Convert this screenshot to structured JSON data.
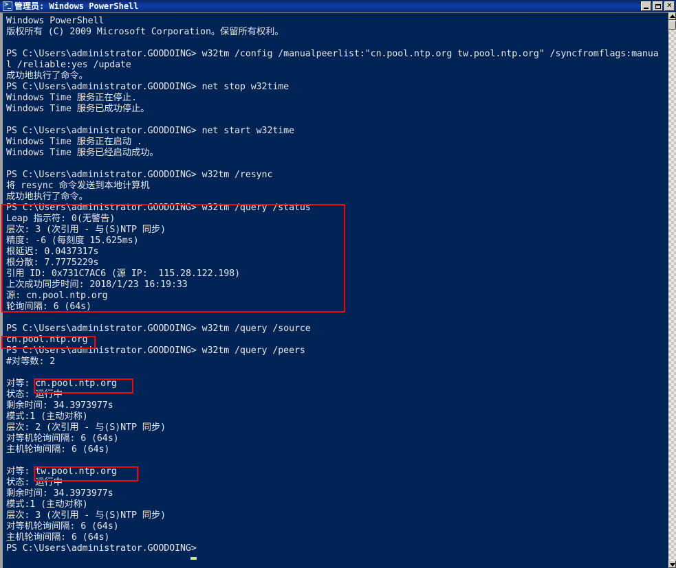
{
  "window": {
    "title": "管理员: Windows PowerShell",
    "icon": "powershell-icon",
    "buttons": {
      "minimize": "_",
      "maximize": "□",
      "close": "✕"
    },
    "background_color": "#012456",
    "text_color": "#e8e8e8",
    "annotation_color": "#ff0000",
    "cursor_color": "#c8e6a0"
  },
  "scrollbar": {
    "up_arrow": "▲",
    "down_arrow": "▼",
    "thumb": "scroll-thumb"
  },
  "console": {
    "prompt": "PS C:\\Users\\administrator.GOODOING>",
    "lines": [
      "Windows PowerShell",
      "版权所有 (C) 2009 Microsoft Corporation。保留所有权利。",
      "",
      "PS C:\\Users\\administrator.GOODOING> w32tm /config /manualpeerlist:\"cn.pool.ntp.org tw.pool.ntp.org\" /syncfromflags:manua",
      "l /reliable:yes /update",
      "成功地执行了命令。",
      "PS C:\\Users\\administrator.GOODOING> net stop w32time",
      "Windows Time 服务正在停止.",
      "Windows Time 服务已成功停止。",
      "",
      "PS C:\\Users\\administrator.GOODOING> net start w32time",
      "Windows Time 服务正在启动 .",
      "Windows Time 服务已经启动成功。",
      "",
      "PS C:\\Users\\administrator.GOODOING> w32tm /resync",
      "将 resync 命令发送到本地计算机",
      "成功地执行了命令。",
      "PS C:\\Users\\administrator.GOODOING> w32tm /query /status",
      "Leap 指示符: 0(无警告)",
      "层次: 3 (次引用 - 与(S)NTP 同步)",
      "精度: -6 (每刻度 15.625ms)",
      "根延迟: 0.0437317s",
      "根分散: 7.7775229s",
      "引用 ID: 0x731C7AC6 (源 IP:  115.28.122.198)",
      "上次成功同步时间: 2018/1/23 16:19:33",
      "源: cn.pool.ntp.org",
      "轮询间隔: 6 (64s)",
      "",
      "PS C:\\Users\\administrator.GOODOING> w32tm /query /source",
      "cn.pool.ntp.org",
      "PS C:\\Users\\administrator.GOODOING> w32tm /query /peers",
      "#对等数: 2",
      "",
      "对等: cn.pool.ntp.org",
      "状态: 运行中",
      "剩余时间: 34.3973977s",
      "模式:1 (主动对称)",
      "层次: 2 (次引用 - 与(S)NTP 同步)",
      "对等机轮询间隔: 6 (64s)",
      "主机轮询间隔: 6 (64s)",
      "",
      "对等: tw.pool.ntp.org",
      "状态: 运行中",
      "剩余时间: 34.3973977s",
      "模式:1 (主动对称)",
      "层次: 3 (次引用 - 与(S)NTP 同步)",
      "对等机轮询间隔: 6 (64s)",
      "主机轮询间隔: 6 (64s)",
      "PS C:\\Users\\administrator.GOODOING> "
    ]
  },
  "annotations": [
    {
      "name": "status-output-highlight",
      "label": "w32tm /query /status output block"
    },
    {
      "name": "source-output-highlight",
      "label": "cn.pool.ntp.org"
    },
    {
      "name": "peer1-name-highlight",
      "label": "cn.pool.ntp.org"
    },
    {
      "name": "peer2-name-highlight",
      "label": "tw.pool.ntp.org"
    }
  ]
}
